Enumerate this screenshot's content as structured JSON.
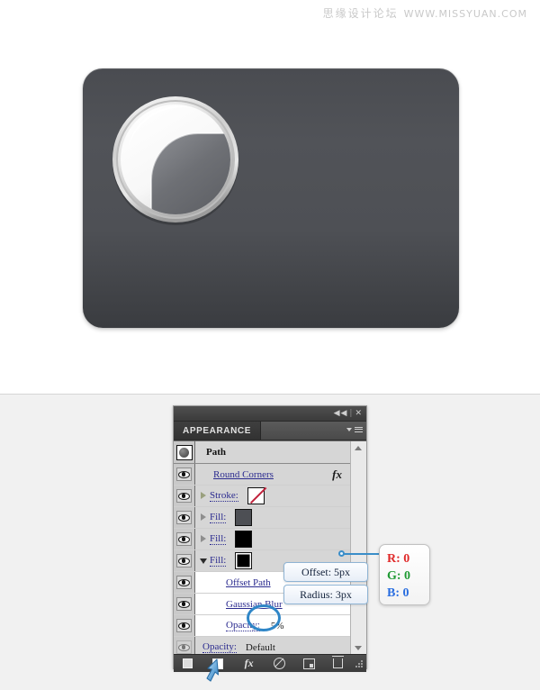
{
  "watermark": {
    "cn": "思缘设计论坛",
    "url": "WWW.MISSYUAN.COM"
  },
  "artwork": {
    "name": "rounded-rectangle-with-sphere",
    "rect_fill_top": "#4f5156",
    "rect_fill_bottom": "#3a3c40",
    "knob_highlight": "#ffffff",
    "knob_shadow": "#6e7075"
  },
  "panel": {
    "titlebar": {
      "collapse_label": "◀◀",
      "separator": "|",
      "close_label": "✕"
    },
    "tab_label": "APPEARANCE",
    "menu_icon": "panel-menu-icon",
    "target": {
      "thumb_icon": "path-thumbnail",
      "name": "Path"
    },
    "rows": [
      {
        "id": "round-corners",
        "label": "Round Corners",
        "style": "link",
        "band": "gray",
        "disclosure": "none",
        "swatch": null,
        "fx": "fx",
        "eye": "on",
        "indent": 1
      },
      {
        "id": "stroke",
        "label": "Stroke:",
        "style": "dotted-link",
        "band": "gray",
        "disclosure": "right",
        "swatch": "none",
        "fx": null,
        "eye": "on",
        "indent": 0
      },
      {
        "id": "fill-1",
        "label": "Fill:",
        "style": "dotted-link",
        "band": "gray",
        "disclosure": "right",
        "swatch": "#4d4f54",
        "fx": null,
        "eye": "on",
        "indent": 0
      },
      {
        "id": "fill-2",
        "label": "Fill:",
        "style": "dotted-link",
        "band": "gray",
        "disclosure": "right",
        "swatch": "#000000",
        "fx": null,
        "eye": "on",
        "indent": 0
      },
      {
        "id": "fill-3",
        "label": "Fill:",
        "style": "dotted-link",
        "band": "gray",
        "disclosure": "down",
        "swatch": "#000000",
        "fx": null,
        "eye": "on",
        "indent": 0,
        "selected": true
      },
      {
        "id": "offset-path",
        "label": "Offset Path",
        "style": "link",
        "band": "white",
        "disclosure": "none",
        "swatch": null,
        "fx": null,
        "eye": "on",
        "indent": 2
      },
      {
        "id": "gaussian-blur",
        "label": "Gaussian Blur",
        "style": "link",
        "band": "white",
        "disclosure": "none",
        "swatch": null,
        "fx": null,
        "eye": "on",
        "indent": 2
      },
      {
        "id": "opacity-child",
        "label": "Opacity:",
        "style": "dotted-link",
        "band": "white",
        "disclosure": "none",
        "swatch": null,
        "value": "5%",
        "fx": null,
        "eye": "on",
        "indent": 2
      },
      {
        "id": "opacity-root",
        "label": "Opacity:",
        "style": "dotted-link",
        "band": "gray",
        "disclosure": "none",
        "swatch": null,
        "value": "Default",
        "fx": null,
        "eye": "dim",
        "indent": 1
      }
    ],
    "footer_icons": [
      {
        "id": "add-new-stroke",
        "name": "filled-square-icon"
      },
      {
        "id": "add-new-fill",
        "name": "open-square-icon"
      },
      {
        "id": "add-new-effect",
        "name": "fx-icon",
        "label": "fx"
      },
      {
        "id": "clear-appearance",
        "name": "no-symbol-icon"
      },
      {
        "id": "duplicate-item",
        "name": "duplicate-icon"
      },
      {
        "id": "delete-item",
        "name": "trash-icon"
      },
      {
        "id": "resize-grip",
        "name": "resize-grip-icon"
      }
    ],
    "scrollbar": {
      "up_arrow": "scroll-up-arrow",
      "down_arrow": "scroll-down-arrow"
    }
  },
  "annotations": {
    "offset_button": "Offset: 5px",
    "radius_button": "Radius: 3px",
    "opacity_highlight": "5%",
    "rgb": {
      "r": "R: 0",
      "g": "G: 0",
      "b": "B: 0",
      "r_color": "#e02a2a",
      "g_color": "#1f9a33",
      "b_color": "#2a6ee0"
    },
    "connector_color": "#3a8ec9",
    "cursor": "blue-arrow-cursor"
  }
}
